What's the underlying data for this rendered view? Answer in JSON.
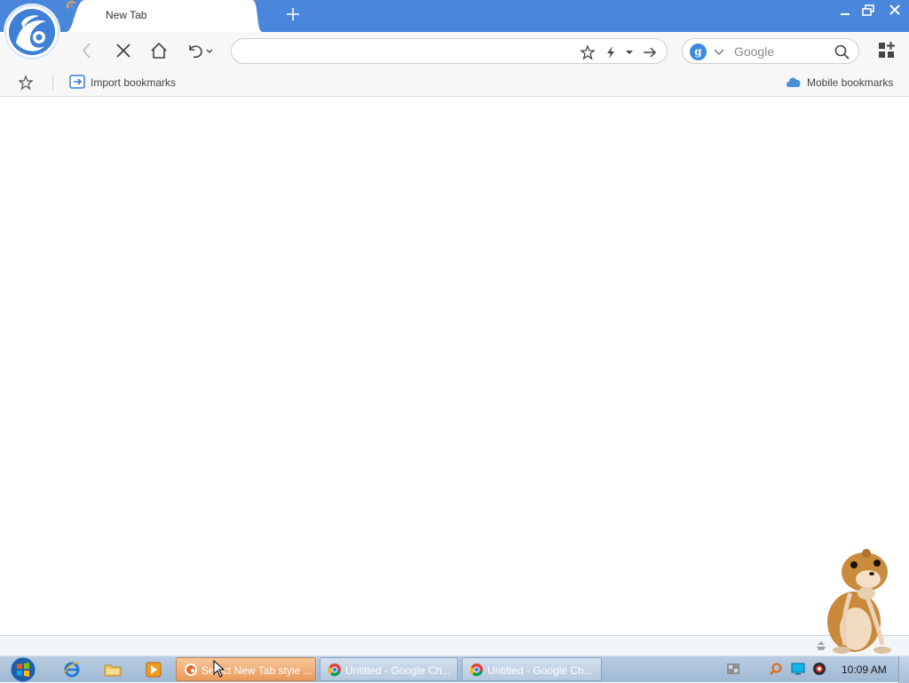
{
  "browser": {
    "tab": {
      "title": "New Tab"
    },
    "search": {
      "placeholder": "Google",
      "engine_letter": "g"
    },
    "address": {
      "value": ""
    }
  },
  "bookmarks": {
    "import_label": "Import bookmarks",
    "mobile_label": "Mobile bookmarks"
  },
  "taskbar": {
    "tasks": [
      {
        "label": "Select New Tab style ...",
        "icon": "uc-browser-icon",
        "active": true
      },
      {
        "label": "Untitled - Google Ch...",
        "icon": "chrome-icon",
        "active": false
      },
      {
        "label": "Untitled - Google Ch...",
        "icon": "chrome-icon",
        "active": false
      }
    ],
    "clock": "10:09 AM"
  },
  "colors": {
    "titlebar": "#4a86dc",
    "accent": "#3b8be0",
    "taskbar": "#a9c0d9",
    "active_task": "#eeaa70"
  }
}
